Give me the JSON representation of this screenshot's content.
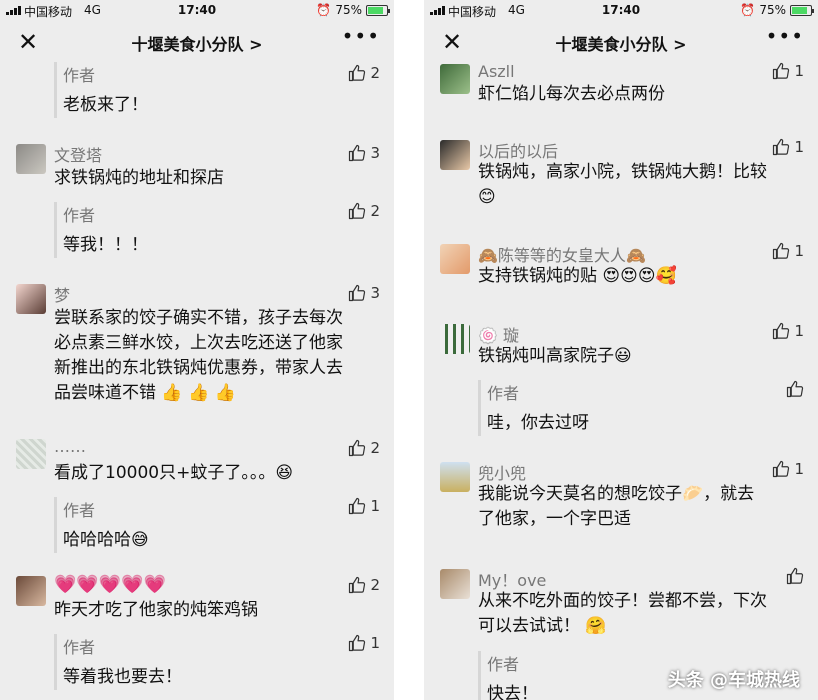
{
  "left": {
    "status": {
      "carrier": "中国移动",
      "network": "4G",
      "time": "17:40",
      "battery": "75%"
    },
    "nav": {
      "title": "十堰美食小分队 >",
      "more": "•••"
    },
    "comments": [
      {
        "reply_name": "作者",
        "reply_text": "老板来了！",
        "reply_likes": "2"
      },
      {
        "name": "文登塔",
        "text": "求铁锅炖的地址和探店",
        "likes": "3",
        "reply_name": "作者",
        "reply_text": "等我！！！",
        "reply_likes": "2"
      },
      {
        "name": "梦",
        "lines": [
          "尝联系家的饺子确实不错，孩子去每次",
          "必点素三鲜水饺，上次去吃还送了他家",
          "新推出的东北铁锅炖优惠券，带家人去",
          "品尝味道不错"
        ],
        "likes": "3"
      },
      {
        "name": "……",
        "text": "看成了10000只+蚊子了。。。",
        "likes": "2",
        "reply_name": "作者",
        "reply_text": "哈哈哈哈",
        "reply_likes": "1"
      },
      {
        "name": "",
        "text": "昨天才吃了他家的炖笨鸡锅",
        "likes": "2",
        "reply_name": "作者",
        "reply_text": "等着我也要去！",
        "reply_likes": "1"
      }
    ]
  },
  "right": {
    "status": {
      "carrier": "中国移动",
      "network": "4G",
      "time": "17:40",
      "battery": "75%"
    },
    "nav": {
      "title": "十堰美食小分队 >",
      "more": "•••"
    },
    "comments": [
      {
        "name": "Aszll",
        "text": "虾仁馅儿每次去必点两份",
        "likes": "1"
      },
      {
        "name": "以后的以后",
        "lines": [
          "铁锅炖，高家小院，铁锅炖大鹅！比较",
          ""
        ],
        "likes": "1"
      },
      {
        "name": "陈等等的女皇大人",
        "text": "支持铁锅炖的贴",
        "likes": "1"
      },
      {
        "name": "璇",
        "text": "铁锅炖叫高家院子",
        "likes": "1",
        "reply_name": "作者",
        "reply_text": "哇，你去过呀",
        "reply_likes": ""
      },
      {
        "name": "兜小兜",
        "lines": [
          "我能说今天莫名的想吃饺子",
          "了他家，一个字巴适"
        ],
        "line1_tail": "，就去",
        "likes": "1"
      },
      {
        "name": "My！ove",
        "lines": [
          "从来不吃外面的饺子！尝都不尝，下次",
          "可以去试试！"
        ],
        "likes": "",
        "reply_name": "作者",
        "reply_text": "快去！"
      }
    ]
  },
  "watermark": "头条 @车城热线"
}
